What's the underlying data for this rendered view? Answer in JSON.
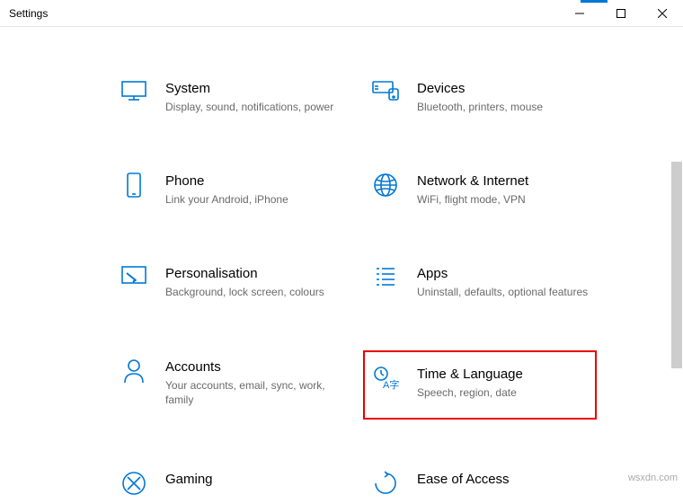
{
  "window": {
    "title": "Settings"
  },
  "categories": [
    {
      "key": "system",
      "title": "System",
      "desc": "Display, sound, notifications, power",
      "highlighted": false
    },
    {
      "key": "devices",
      "title": "Devices",
      "desc": "Bluetooth, printers, mouse",
      "highlighted": false
    },
    {
      "key": "phone",
      "title": "Phone",
      "desc": "Link your Android, iPhone",
      "highlighted": false
    },
    {
      "key": "network",
      "title": "Network & Internet",
      "desc": "WiFi, flight mode, VPN",
      "highlighted": false
    },
    {
      "key": "personalisation",
      "title": "Personalisation",
      "desc": "Background, lock screen, colours",
      "highlighted": false
    },
    {
      "key": "apps",
      "title": "Apps",
      "desc": "Uninstall, defaults, optional features",
      "highlighted": false
    },
    {
      "key": "accounts",
      "title": "Accounts",
      "desc": "Your accounts, email, sync, work, family",
      "highlighted": false
    },
    {
      "key": "time-language",
      "title": "Time & Language",
      "desc": "Speech, region, date",
      "highlighted": true
    },
    {
      "key": "gaming",
      "title": "Gaming",
      "desc": "",
      "highlighted": false
    },
    {
      "key": "ease-of-access",
      "title": "Ease of Access",
      "desc": "",
      "highlighted": false
    }
  ],
  "watermark": "wsxdn.com"
}
